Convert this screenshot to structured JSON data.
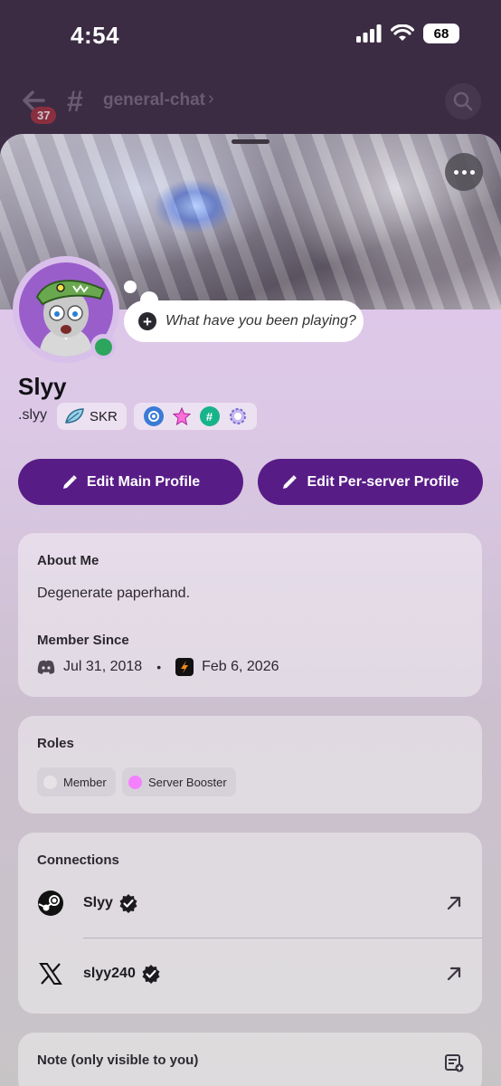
{
  "status_bar": {
    "time": "4:54",
    "battery": "68"
  },
  "chat_header": {
    "back_badge": "37",
    "hash": "#",
    "channel": "general-chat",
    "chevron": "›"
  },
  "profile": {
    "status_prompt": "What have you been playing?",
    "display_name": "Slyy",
    "username": ".slyy",
    "clan_tag": "SKR",
    "badges": [
      "nitro-badge",
      "quest-badge",
      "hypesquad-badge",
      "boost-badge"
    ],
    "online_status_color": "#2ea55d",
    "buttons": {
      "edit_main": "Edit Main Profile",
      "edit_server": "Edit Per-server Profile"
    },
    "accent_color": "#581c87"
  },
  "about": {
    "title": "About Me",
    "text": "Degenerate paperhand.",
    "member_since_title": "Member Since",
    "discord_date": "Jul 31, 2018",
    "separator": "•",
    "server_date": "Feb 6, 2026"
  },
  "roles": {
    "title": "Roles",
    "items": [
      {
        "label": "Member",
        "color": "#e6e2e6"
      },
      {
        "label": "Server Booster",
        "color": "#f47fff"
      }
    ]
  },
  "connections": {
    "title": "Connections",
    "items": [
      {
        "service": "steam",
        "name": "Slyy",
        "verified": true
      },
      {
        "service": "x",
        "name": "slyy240",
        "verified": true
      }
    ]
  },
  "note": {
    "title": "Note (only visible to you)"
  }
}
